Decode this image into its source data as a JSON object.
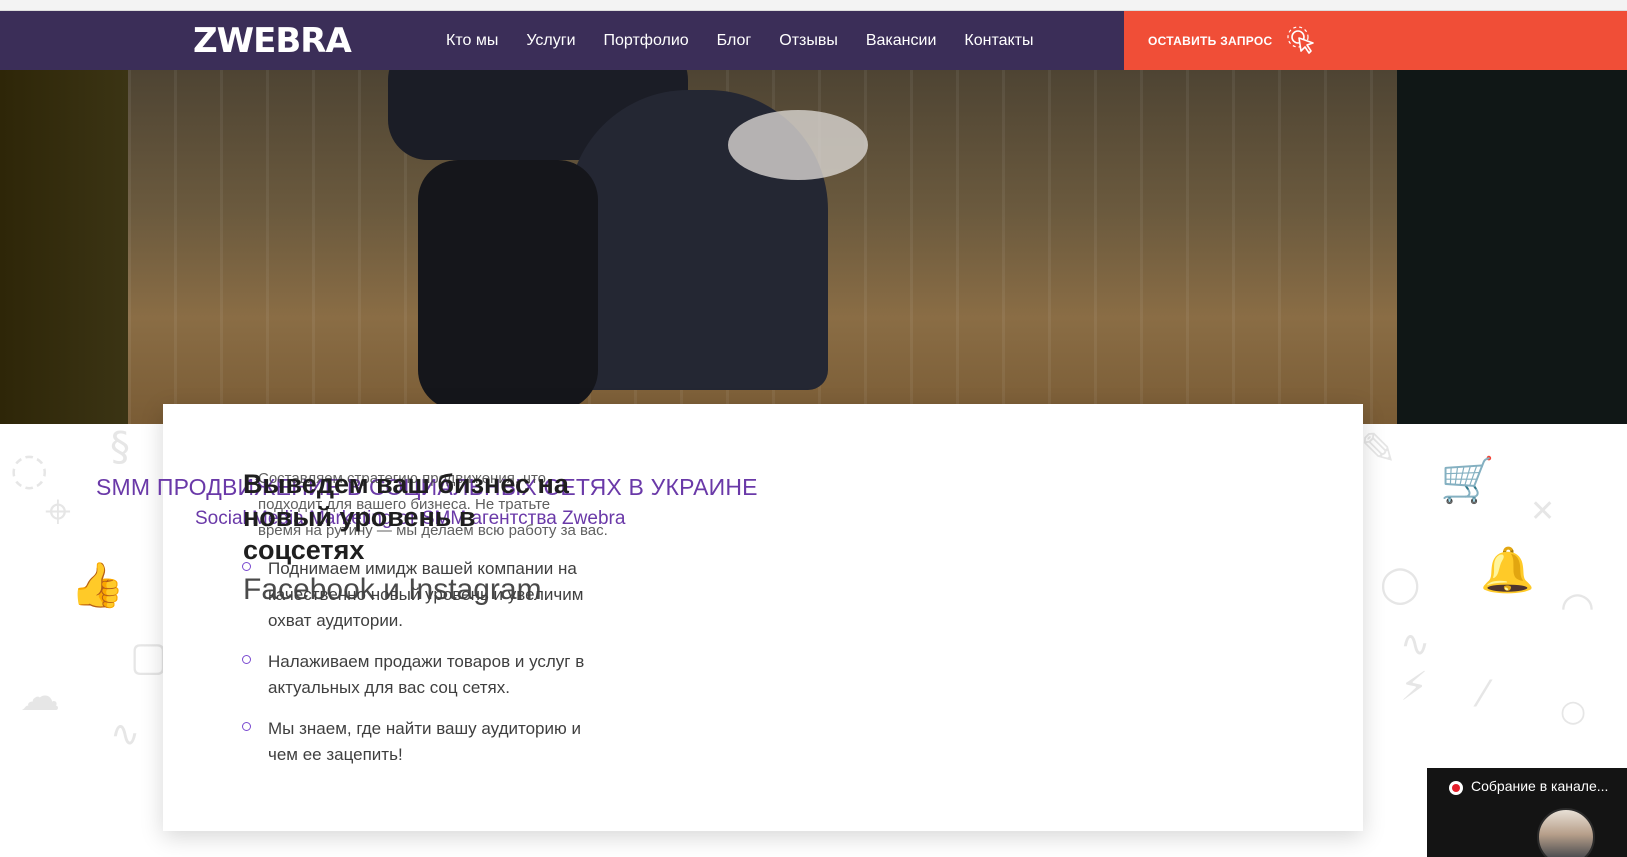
{
  "brand": {
    "logo": "ZWEBRA"
  },
  "nav": {
    "items": [
      "Кто мы",
      "Услуги",
      "Портфолио",
      "Блог",
      "Отзывы",
      "Вакансии",
      "Контакты"
    ],
    "cta_label": "ОСТАВИТЬ ЗАПРОС",
    "cta_icon": "cursor-click-icon"
  },
  "section": {
    "title": "SMM ПРОДВИЖЕНИЕ В СОЦИАЛЬНЫХ СЕТЯХ В УКРАИНЕ",
    "subtitle": "Social Media Marketing от SMM агентства Zwebra",
    "heading": "Выведем ваш бизнес на новый уровень в соцсетях",
    "heading_sub": "Facebook и Instagram",
    "overlap_lines": [
      "Составляем стратегию продвижения, что",
      "подходит для вашего бизнеса. Не тратьте",
      "время на рутину — мы делаем всю работу за вас."
    ],
    "features": [
      "Поднимаем имидж вашей компании на качественно новый уровень и увеличим охват аудитории.",
      "Налаживаем продажи товаров и услуг в актуальных для вас соц сетях.",
      "Мы знаем, где найти вашу аудиторию и чем ее зацепить!"
    ]
  },
  "meeting": {
    "title": "Собрание в канале...",
    "status_color": "#e41e2a"
  }
}
